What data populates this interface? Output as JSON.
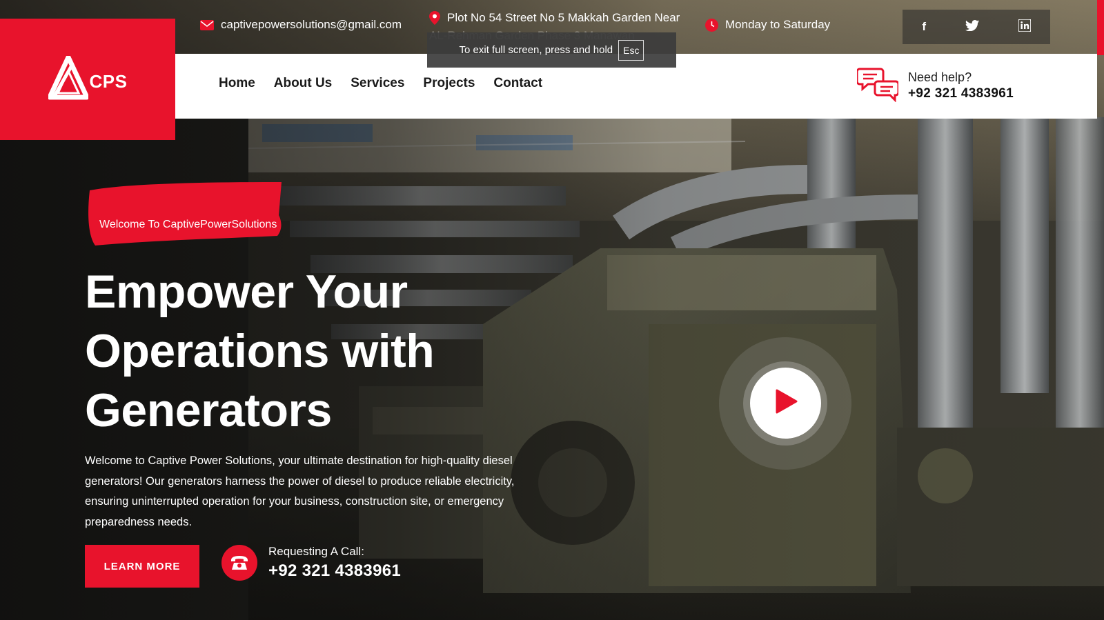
{
  "topbar": {
    "email": "captivepowersolutions@gmail.com",
    "address_line1": "Plot No 54 Street No 5 Makkah Garden Near",
    "address_line2": "AL-Rehman Garden Phase 3 Manawan",
    "hours": "Monday to Saturday",
    "social": [
      {
        "icon": "facebook-icon",
        "glyph": "f"
      },
      {
        "icon": "twitter-icon",
        "glyph": "🐦"
      },
      {
        "icon": "linkedin-icon",
        "glyph": "in"
      }
    ]
  },
  "fullscreen_toast": {
    "message": "To exit full screen, press and hold",
    "key": "Esc"
  },
  "logo": {
    "text": "CPS"
  },
  "nav": {
    "items": [
      "Home",
      "About Us",
      "Services",
      "Projects",
      "Contact"
    ]
  },
  "help": {
    "label": "Need help?",
    "phone": "+92 321 4383961"
  },
  "hero": {
    "badge": "Welcome To CaptivePowerSolutions",
    "title_lines": [
      "Empower Your",
      "Operations with",
      "Generators"
    ],
    "description": "Welcome to Captive Power Solutions, your ultimate destination for high-quality diesel generators! Our generators harness the power of diesel to produce reliable electricity, ensuring uninterrupted operation for your business, construction site, or emergency preparedness needs.",
    "cta_label": "LEARN MORE",
    "call_label": "Requesting A Call:",
    "call_phone": "+92 321 4383961"
  },
  "colors": {
    "accent": "#e8132c",
    "white": "#ffffff",
    "text_dark": "#1a1a1a"
  }
}
